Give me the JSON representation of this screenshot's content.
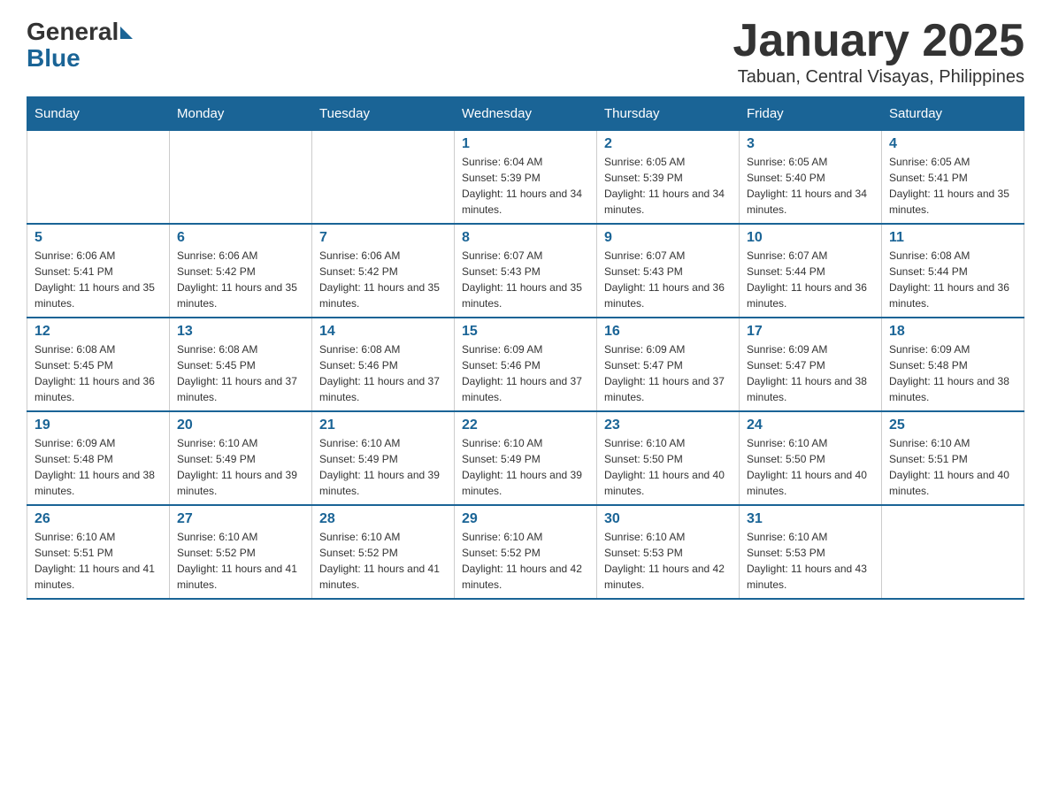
{
  "header": {
    "logo_general": "General",
    "logo_blue": "Blue",
    "month_title": "January 2025",
    "location": "Tabuan, Central Visayas, Philippines"
  },
  "days_of_week": [
    "Sunday",
    "Monday",
    "Tuesday",
    "Wednesday",
    "Thursday",
    "Friday",
    "Saturday"
  ],
  "weeks": [
    [
      {
        "day": "",
        "info": ""
      },
      {
        "day": "",
        "info": ""
      },
      {
        "day": "",
        "info": ""
      },
      {
        "day": "1",
        "info": "Sunrise: 6:04 AM\nSunset: 5:39 PM\nDaylight: 11 hours and 34 minutes."
      },
      {
        "day": "2",
        "info": "Sunrise: 6:05 AM\nSunset: 5:39 PM\nDaylight: 11 hours and 34 minutes."
      },
      {
        "day": "3",
        "info": "Sunrise: 6:05 AM\nSunset: 5:40 PM\nDaylight: 11 hours and 34 minutes."
      },
      {
        "day": "4",
        "info": "Sunrise: 6:05 AM\nSunset: 5:41 PM\nDaylight: 11 hours and 35 minutes."
      }
    ],
    [
      {
        "day": "5",
        "info": "Sunrise: 6:06 AM\nSunset: 5:41 PM\nDaylight: 11 hours and 35 minutes."
      },
      {
        "day": "6",
        "info": "Sunrise: 6:06 AM\nSunset: 5:42 PM\nDaylight: 11 hours and 35 minutes."
      },
      {
        "day": "7",
        "info": "Sunrise: 6:06 AM\nSunset: 5:42 PM\nDaylight: 11 hours and 35 minutes."
      },
      {
        "day": "8",
        "info": "Sunrise: 6:07 AM\nSunset: 5:43 PM\nDaylight: 11 hours and 35 minutes."
      },
      {
        "day": "9",
        "info": "Sunrise: 6:07 AM\nSunset: 5:43 PM\nDaylight: 11 hours and 36 minutes."
      },
      {
        "day": "10",
        "info": "Sunrise: 6:07 AM\nSunset: 5:44 PM\nDaylight: 11 hours and 36 minutes."
      },
      {
        "day": "11",
        "info": "Sunrise: 6:08 AM\nSunset: 5:44 PM\nDaylight: 11 hours and 36 minutes."
      }
    ],
    [
      {
        "day": "12",
        "info": "Sunrise: 6:08 AM\nSunset: 5:45 PM\nDaylight: 11 hours and 36 minutes."
      },
      {
        "day": "13",
        "info": "Sunrise: 6:08 AM\nSunset: 5:45 PM\nDaylight: 11 hours and 37 minutes."
      },
      {
        "day": "14",
        "info": "Sunrise: 6:08 AM\nSunset: 5:46 PM\nDaylight: 11 hours and 37 minutes."
      },
      {
        "day": "15",
        "info": "Sunrise: 6:09 AM\nSunset: 5:46 PM\nDaylight: 11 hours and 37 minutes."
      },
      {
        "day": "16",
        "info": "Sunrise: 6:09 AM\nSunset: 5:47 PM\nDaylight: 11 hours and 37 minutes."
      },
      {
        "day": "17",
        "info": "Sunrise: 6:09 AM\nSunset: 5:47 PM\nDaylight: 11 hours and 38 minutes."
      },
      {
        "day": "18",
        "info": "Sunrise: 6:09 AM\nSunset: 5:48 PM\nDaylight: 11 hours and 38 minutes."
      }
    ],
    [
      {
        "day": "19",
        "info": "Sunrise: 6:09 AM\nSunset: 5:48 PM\nDaylight: 11 hours and 38 minutes."
      },
      {
        "day": "20",
        "info": "Sunrise: 6:10 AM\nSunset: 5:49 PM\nDaylight: 11 hours and 39 minutes."
      },
      {
        "day": "21",
        "info": "Sunrise: 6:10 AM\nSunset: 5:49 PM\nDaylight: 11 hours and 39 minutes."
      },
      {
        "day": "22",
        "info": "Sunrise: 6:10 AM\nSunset: 5:49 PM\nDaylight: 11 hours and 39 minutes."
      },
      {
        "day": "23",
        "info": "Sunrise: 6:10 AM\nSunset: 5:50 PM\nDaylight: 11 hours and 40 minutes."
      },
      {
        "day": "24",
        "info": "Sunrise: 6:10 AM\nSunset: 5:50 PM\nDaylight: 11 hours and 40 minutes."
      },
      {
        "day": "25",
        "info": "Sunrise: 6:10 AM\nSunset: 5:51 PM\nDaylight: 11 hours and 40 minutes."
      }
    ],
    [
      {
        "day": "26",
        "info": "Sunrise: 6:10 AM\nSunset: 5:51 PM\nDaylight: 11 hours and 41 minutes."
      },
      {
        "day": "27",
        "info": "Sunrise: 6:10 AM\nSunset: 5:52 PM\nDaylight: 11 hours and 41 minutes."
      },
      {
        "day": "28",
        "info": "Sunrise: 6:10 AM\nSunset: 5:52 PM\nDaylight: 11 hours and 41 minutes."
      },
      {
        "day": "29",
        "info": "Sunrise: 6:10 AM\nSunset: 5:52 PM\nDaylight: 11 hours and 42 minutes."
      },
      {
        "day": "30",
        "info": "Sunrise: 6:10 AM\nSunset: 5:53 PM\nDaylight: 11 hours and 42 minutes."
      },
      {
        "day": "31",
        "info": "Sunrise: 6:10 AM\nSunset: 5:53 PM\nDaylight: 11 hours and 43 minutes."
      },
      {
        "day": "",
        "info": ""
      }
    ]
  ]
}
